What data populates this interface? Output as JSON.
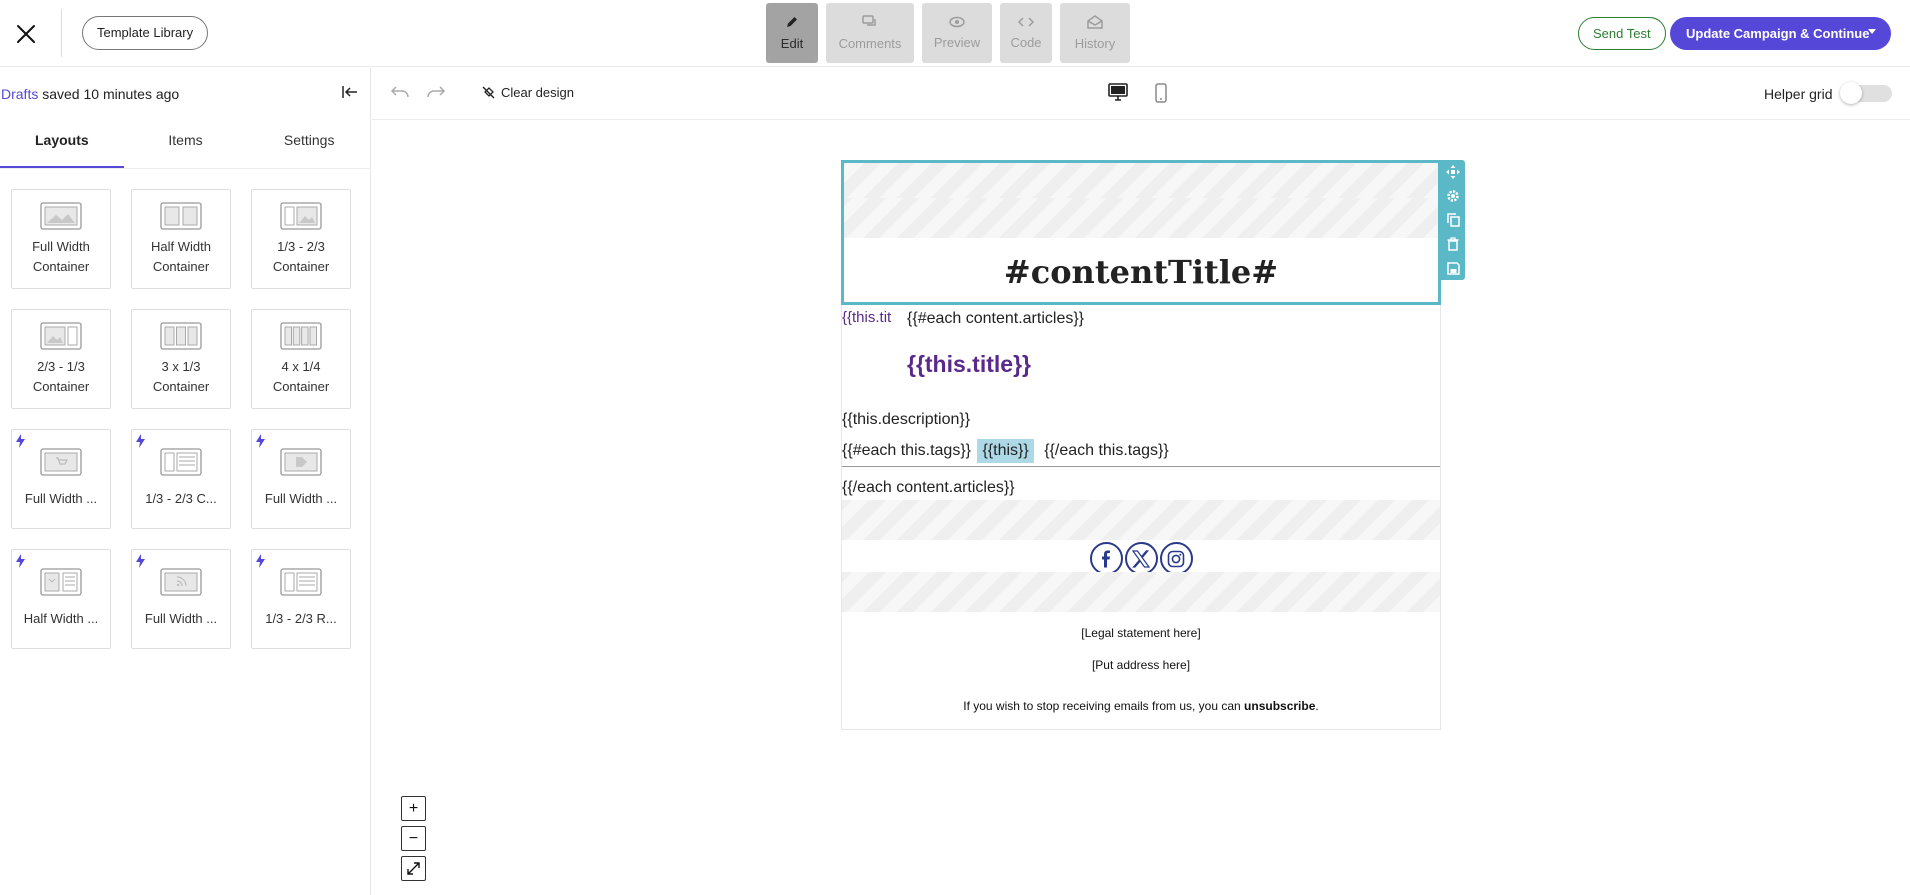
{
  "header": {
    "template_library_label": "Template Library",
    "modes": [
      {
        "label": "Edit",
        "icon": "pencil-icon",
        "active": true
      },
      {
        "label": "Comments",
        "icon": "comments-icon",
        "active": false
      },
      {
        "label": "Preview",
        "icon": "eye-icon",
        "active": false
      },
      {
        "label": "Code",
        "icon": "code-icon",
        "active": false
      },
      {
        "label": "History",
        "icon": "envelope-icon",
        "active": false
      }
    ],
    "send_test_label": "Send Test",
    "update_label": "Update Campaign & Continue"
  },
  "sidebar": {
    "save_status": {
      "drafts_link": "Drafts",
      "text": " saved 10 minutes ago"
    },
    "tabs": [
      {
        "label": "Layouts",
        "active": true
      },
      {
        "label": "Items",
        "active": false
      },
      {
        "label": "Settings",
        "active": false
      }
    ],
    "layouts": [
      {
        "label": "Full Width Container",
        "icon": "full-width-layout-icon",
        "premium": false
      },
      {
        "label": "Half Width Container",
        "icon": "half-width-layout-icon",
        "premium": false
      },
      {
        "label": "1/3 - 2/3 Container",
        "icon": "one-third-two-thirds-layout-icon",
        "premium": false
      },
      {
        "label": "2/3 - 1/3 Container",
        "icon": "two-thirds-one-third-layout-icon",
        "premium": false
      },
      {
        "label": "3 x 1/3 Container",
        "icon": "three-column-layout-icon",
        "premium": false
      },
      {
        "label": "4 x 1/4 Container",
        "icon": "four-column-layout-icon",
        "premium": false
      },
      {
        "label": "Full Width ...",
        "icon": "full-width-cart-layout-icon",
        "premium": true
      },
      {
        "label": "1/3 - 2/3 C...",
        "icon": "one-third-two-thirds-text-layout-icon",
        "premium": true
      },
      {
        "label": "Full Width ...",
        "icon": "full-width-tag-layout-icon",
        "premium": true
      },
      {
        "label": "Half Width ...",
        "icon": "half-width-text-layout-icon",
        "premium": true
      },
      {
        "label": "Full Width ...",
        "icon": "full-width-rss-layout-icon",
        "premium": true
      },
      {
        "label": "1/3 - 2/3 R...",
        "icon": "one-third-two-thirds-rss-layout-icon",
        "premium": true
      }
    ]
  },
  "toolbar": {
    "clear_design_label": "Clear design",
    "helper_grid_label": "Helper grid",
    "helper_grid_on": false
  },
  "email": {
    "content_title": "#contentTitle#",
    "broken_image_alt": "{{this.title}}",
    "each_open": "{{#each content.articles}}",
    "this_title": "{{this.title}}",
    "description": "{{this.description}}",
    "tags_open": "{{#each this.tags}}",
    "tag_pill": "{{this}}",
    "tags_close": "{{/each this.tags}}",
    "each_close": "{{/each content.articles}}",
    "social": [
      "facebook-icon",
      "x-twitter-icon",
      "instagram-icon"
    ],
    "legal": "[Legal statement here]",
    "address": "[Put address here]",
    "unsubscribe_prefix": "If you wish to stop receiving emails from us, you can ",
    "unsubscribe_link": "unsubscribe",
    "unsubscribe_suffix": "."
  },
  "colors": {
    "accent": "#5548d9",
    "selection": "#5bb8c6",
    "send_test": "#2e7d32",
    "template_var": "#5a2a8a"
  }
}
